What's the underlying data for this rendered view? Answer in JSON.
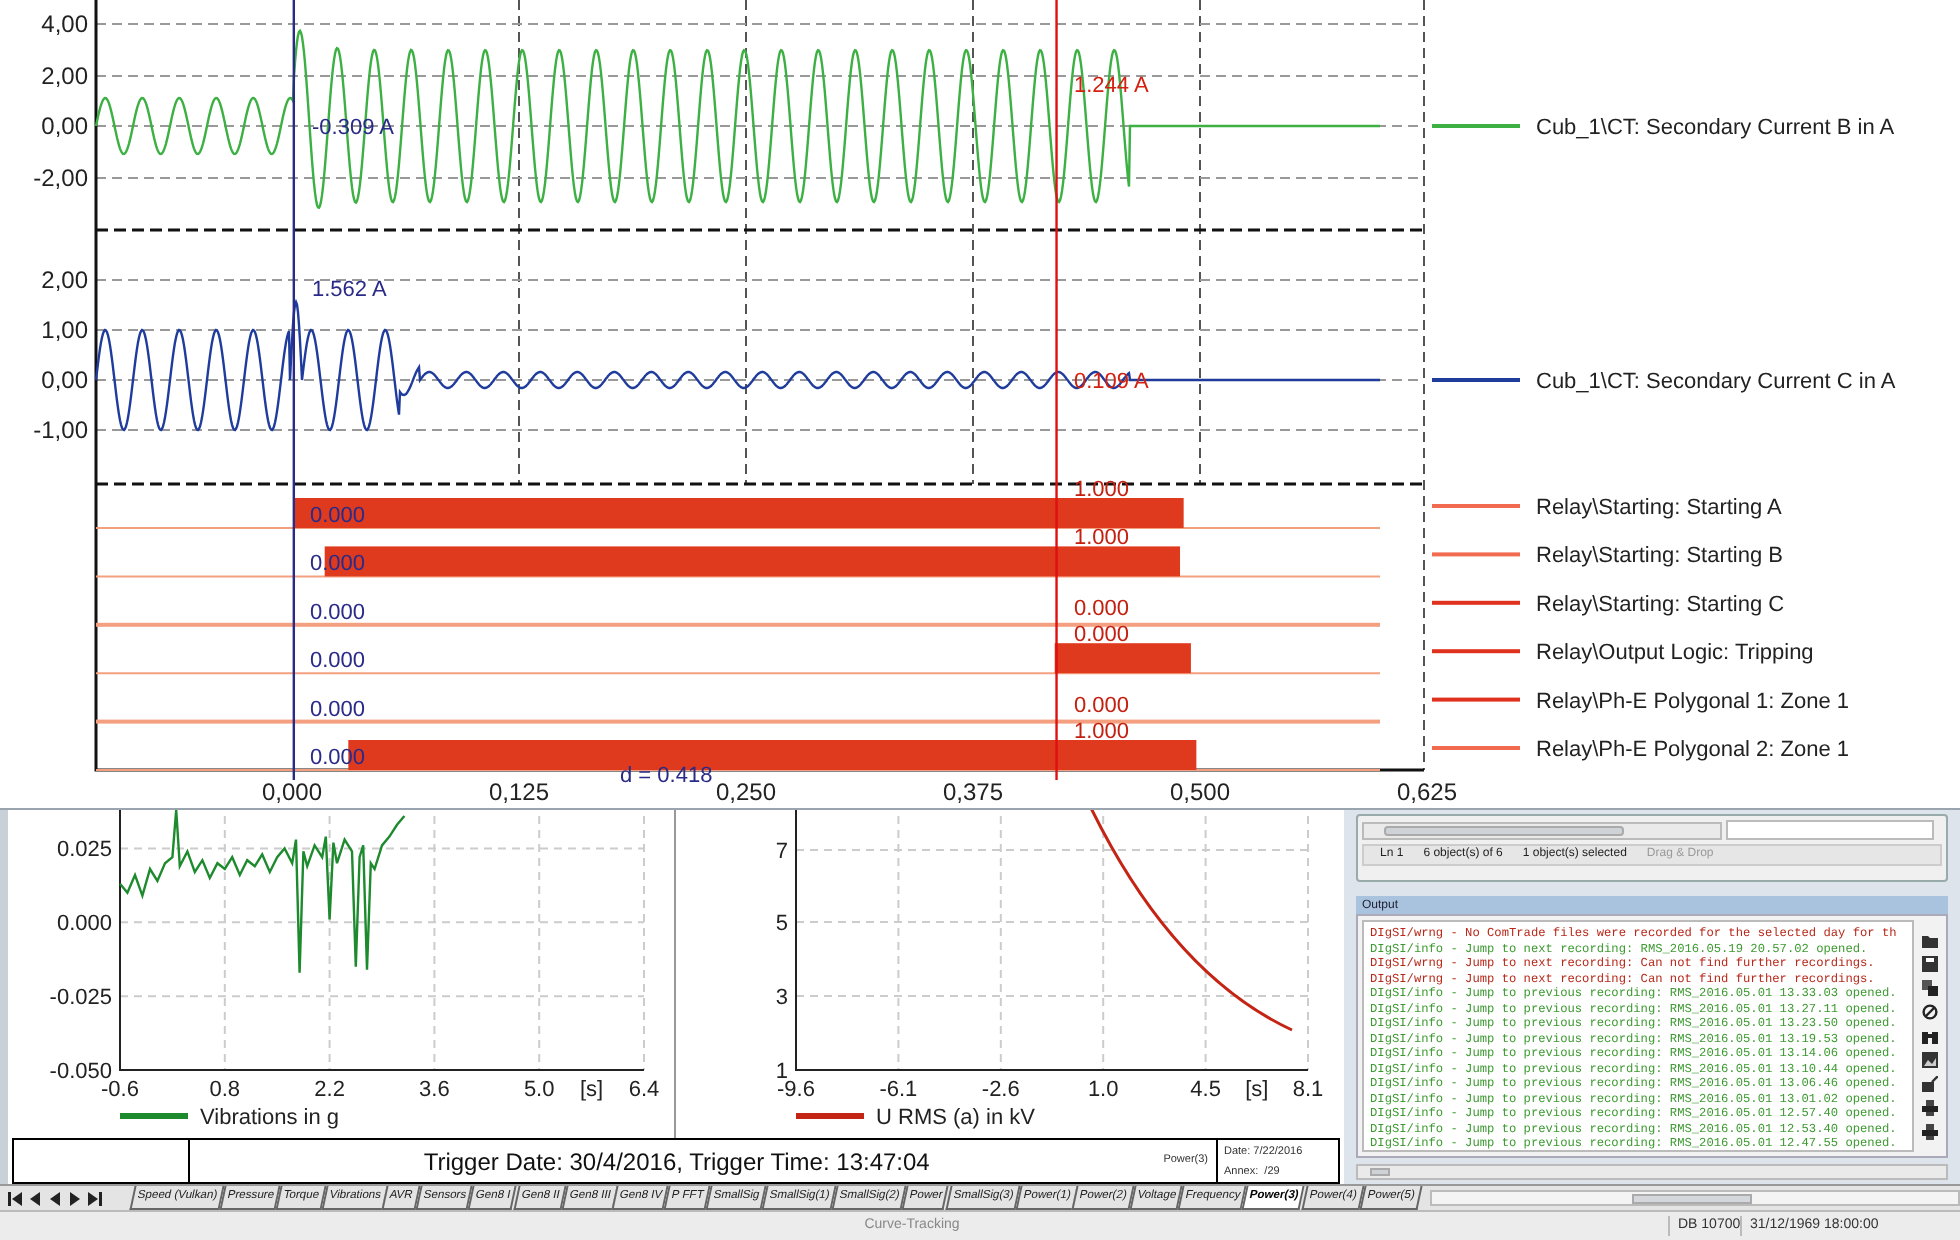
{
  "waveform_chart": {
    "x_ticks": [
      "0,000",
      "0,125",
      "0,250",
      "0,375",
      "0,500",
      "0,625"
    ],
    "cursors": [
      {
        "kind": "reference"
      },
      {
        "kind": "measure"
      }
    ],
    "cursor_difference": "d = 0.418",
    "analog_panels": [
      {
        "kind": "current_b",
        "y_ticks": [
          "4,00",
          "2,00",
          "0,00",
          "-2,00"
        ],
        "legend": "Cub_1\\CT: Secondary Current B in A",
        "color": "#3cb043",
        "readings": [
          {
            "kind": "reference",
            "text": "-0.309 A"
          },
          {
            "kind": "measure",
            "text": "1.244 A"
          }
        ]
      },
      {
        "kind": "current_c",
        "y_ticks": [
          "2,00",
          "1,00",
          "0,00",
          "-1,00"
        ],
        "legend": "Cub_1\\CT: Secondary Current C in A",
        "color": "#1f3c9c",
        "readings": [
          {
            "kind": "reference",
            "text": "1.562 A"
          },
          {
            "kind": "measure",
            "text": "0.109 A"
          }
        ]
      }
    ],
    "binary_rows": [
      {
        "legend": "Relay\\Starting: Starting A",
        "color": "#f26a4f",
        "reference_value": "0.000",
        "measure_value": "1.000",
        "active": true
      },
      {
        "legend": "Relay\\Starting: Starting B",
        "color": "#f26a4f",
        "reference_value": "0.000",
        "measure_value": "1.000",
        "active": true
      },
      {
        "legend": "Relay\\Starting: Starting C",
        "color": "#e0301e",
        "reference_value": "0.000",
        "measure_value": "0.000",
        "active": false
      },
      {
        "legend": "Relay\\Output Logic: Tripping",
        "color": "#e0301e",
        "reference_value": "0.000",
        "measure_value": "0.000",
        "active": true
      },
      {
        "legend": "Relay\\Ph-E Polygonal 1: Zone 1",
        "color": "#e0301e",
        "reference_value": "0.000",
        "measure_value": "0.000",
        "active": false
      },
      {
        "legend": "Relay\\Ph-E Polygonal 2: Zone 1",
        "color": "#f26a4f",
        "reference_value": "0.000",
        "measure_value": "1.000",
        "active": true
      }
    ]
  },
  "trend_charts": [
    {
      "kind": "vibration",
      "unit": "[s]",
      "chart_data": {
        "type": "line",
        "grid": true,
        "xlim": [
          -0.6,
          6.4
        ],
        "ylim": [
          -0.05,
          0.038
        ],
        "xticks": [
          -0.6,
          0.8,
          2.2,
          3.6,
          {
            "value": 5,
            "label": "5.0"
          },
          6.4
        ],
        "yticks": [
          {
            "value": 0.025,
            "label": "0.025"
          },
          {
            "value": 0,
            "label": "0.000"
          },
          {
            "value": -0.025,
            "label": "-0.025"
          },
          {
            "value": -0.05,
            "label": "-0.050"
          }
        ],
        "x": [
          -0.6,
          -0.5,
          -0.4,
          -0.3,
          -0.2,
          -0.1,
          0.0,
          0.1,
          0.15,
          0.2,
          0.3,
          0.4,
          0.5,
          0.6,
          0.7,
          0.8,
          0.9,
          1.0,
          1.1,
          1.2,
          1.3,
          1.4,
          1.5,
          1.6,
          1.7,
          1.75,
          1.8,
          1.85,
          1.9,
          2.0,
          2.1,
          2.15,
          2.2,
          2.25,
          2.3,
          2.4,
          2.5,
          2.55,
          2.6,
          2.65,
          2.7,
          2.75,
          2.8,
          2.9,
          3.0,
          3.1,
          3.2
        ],
        "series": [
          {
            "name": "Vibrations in g",
            "color": "#1e8a2e",
            "values": [
              0.013,
              0.01,
              0.016,
              0.009,
              0.018,
              0.014,
              0.02,
              0.022,
              0.038,
              0.019,
              0.024,
              0.017,
              0.021,
              0.015,
              0.02,
              0.018,
              0.022,
              0.016,
              0.021,
              0.019,
              0.023,
              0.017,
              0.022,
              0.025,
              0.02,
              0.028,
              -0.017,
              0.024,
              0.019,
              0.026,
              0.022,
              0.029,
              0.001,
              0.027,
              0.02,
              0.028,
              0.024,
              -0.015,
              0.022,
              0.026,
              -0.016,
              0.02,
              0.018,
              0.026,
              0.029,
              0.033,
              0.036
            ]
          }
        ]
      }
    },
    {
      "kind": "voltage",
      "y_ticks": [
        "7",
        "5",
        "3",
        "1"
      ],
      "x_ticks": [
        "-9.6",
        "-6.1",
        "-2.6",
        "1.0",
        "4.5",
        "8.1"
      ],
      "unit": "[s]",
      "legend": "U RMS (a) in kV",
      "color": "#c42414"
    }
  ],
  "report_footer": {
    "trigger": "Trigger Date: 30/4/2016, Trigger Time: 13:47:04",
    "sheet": "Power(3)",
    "date": "Date: 7/22/2016",
    "annex": "Annex:  /29"
  },
  "object_list_status": [
    {
      "text": "Ln 1",
      "disabled": false
    },
    {
      "text": "6 object(s) of 6",
      "disabled": false
    },
    {
      "text": "1 object(s) selected",
      "disabled": false
    },
    {
      "text": "Drag & Drop",
      "disabled": true
    }
  ],
  "output": {
    "title": "Output",
    "lines": [
      {
        "kind": "warning",
        "text": "DIgSI/wrng - No ComTrade files were recorded for the selected day for th"
      },
      {
        "kind": "info",
        "text": "DIgSI/info - Jump to next recording: RMS_2016.05.19 20.57.02 opened."
      },
      {
        "kind": "warning",
        "text": "DIgSI/wrng - Jump to next recording: Can not find further recordings."
      },
      {
        "kind": "warning",
        "text": "DIgSI/wrng - Jump to next recording: Can not find further recordings."
      },
      {
        "kind": "info",
        "text": "DIgSI/info - Jump to previous recording: RMS_2016.05.01 13.33.03 opened."
      },
      {
        "kind": "info",
        "text": "DIgSI/info - Jump to previous recording: RMS_2016.05.01 13.27.11 opened."
      },
      {
        "kind": "info",
        "text": "DIgSI/info - Jump to previous recording: RMS_2016.05.01 13.23.50 opened."
      },
      {
        "kind": "info",
        "text": "DIgSI/info - Jump to previous recording: RMS_2016.05.01 13.19.53 opened."
      },
      {
        "kind": "info",
        "text": "DIgSI/info - Jump to previous recording: RMS_2016.05.01 13.14.06 opened."
      },
      {
        "kind": "info",
        "text": "DIgSI/info - Jump to previous recording: RMS_2016.05.01 13.10.44 opened."
      },
      {
        "kind": "info",
        "text": "DIgSI/info - Jump to previous recording: RMS_2016.05.01 13.06.46 opened."
      },
      {
        "kind": "info",
        "text": "DIgSI/info - Jump to previous recording: RMS_2016.05.01 13.01.02 opened."
      },
      {
        "kind": "info",
        "text": "DIgSI/info - Jump to previous recording: RMS_2016.05.01 12.57.40 opened."
      },
      {
        "kind": "info",
        "text": "DIgSI/info - Jump to previous recording: RMS_2016.05.01 12.53.40 opened."
      },
      {
        "kind": "info",
        "text": "DIgSI/info - Jump to previous recording: RMS_2016.05.01 12.47.55 opened."
      }
    ]
  },
  "sheet_tabs": [
    {
      "label": "Speed (Vulkan)",
      "selected": false
    },
    {
      "label": "Pressure",
      "selected": false
    },
    {
      "label": "Torque",
      "selected": false
    },
    {
      "label": "Vibrations",
      "selected": false
    },
    {
      "label": "AVR",
      "selected": false
    },
    {
      "label": "Sensors",
      "selected": false
    },
    {
      "label": "Gen8 I",
      "selected": false
    },
    {
      "label": "Gen8 II",
      "selected": false
    },
    {
      "label": "Gen8 III",
      "selected": false
    },
    {
      "label": "Gen8 IV",
      "selected": false
    },
    {
      "label": "P FFT",
      "selected": false
    },
    {
      "label": "SmallSig",
      "selected": false
    },
    {
      "label": "SmallSig(1)",
      "selected": false
    },
    {
      "label": "SmallSig(2)",
      "selected": false
    },
    {
      "label": "Power",
      "selected": false
    },
    {
      "label": "SmallSig(3)",
      "selected": false
    },
    {
      "label": "Power(1)",
      "selected": false
    },
    {
      "label": "Power(2)",
      "selected": false
    },
    {
      "label": "Voltage",
      "selected": false
    },
    {
      "label": "Frequency",
      "selected": false
    },
    {
      "label": "Power(3)",
      "selected": true
    },
    {
      "label": "Power(4)",
      "selected": false
    },
    {
      "label": "Power(5)",
      "selected": false
    }
  ],
  "status_bar": {
    "mode": "Curve-Tracking",
    "database": "DB 10700",
    "timestamp": "31/12/1969 18:00:00"
  }
}
